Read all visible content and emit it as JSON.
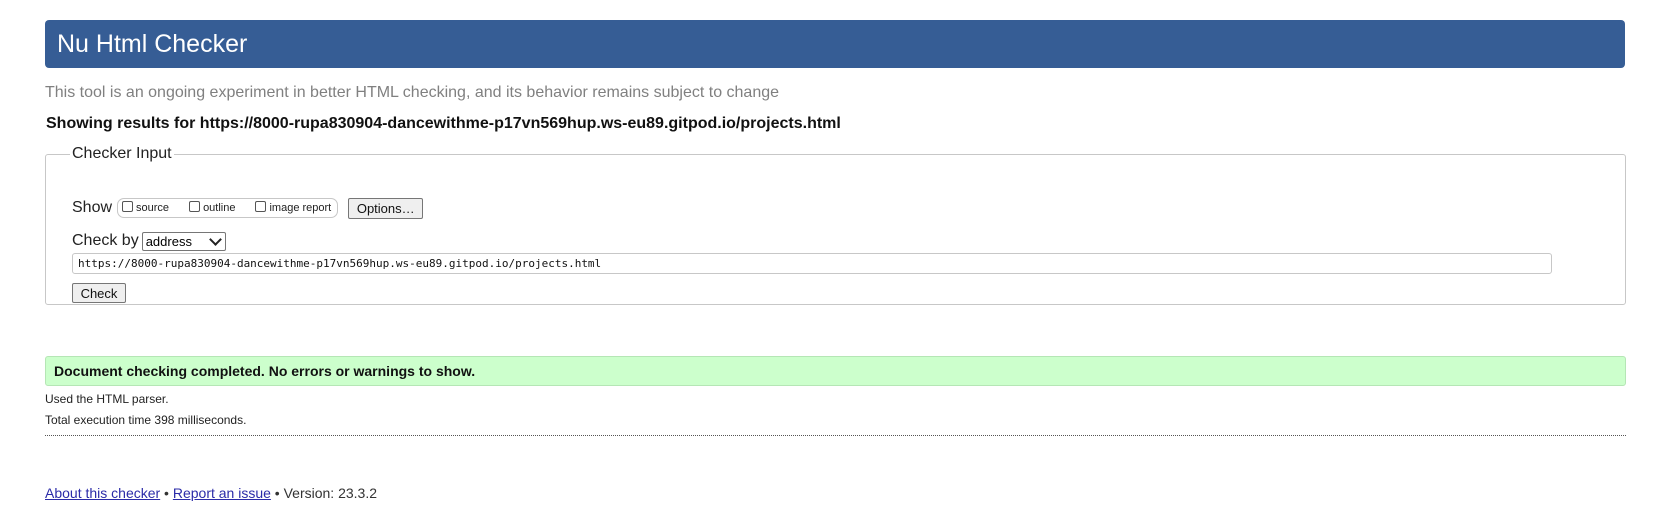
{
  "header": {
    "title": "Nu Html Checker"
  },
  "tagline": "This tool is an ongoing experiment in better HTML checking, and its behavior remains subject to change",
  "results_for": "Showing results for https://8000-rupa830904-dancewithme-p17vn569hup.ws-eu89.gitpod.io/projects.html",
  "checker_input": {
    "legend": "Checker Input",
    "show_label": "Show",
    "show_options": [
      {
        "label": "source",
        "checked": false
      },
      {
        "label": "outline",
        "checked": false
      },
      {
        "label": "image report",
        "checked": false
      }
    ],
    "options_button": "Options…",
    "check_by_label": "Check by",
    "check_by_value": "address",
    "url_value": "https://8000-rupa830904-dancewithme-p17vn569hup.ws-eu89.gitpod.io/projects.html",
    "check_button": "Check"
  },
  "result": {
    "message": "Document checking completed. No errors or warnings to show.",
    "parser_note": "Used the HTML parser.",
    "time_note": "Total execution time 398 milliseconds."
  },
  "footer": {
    "about_link": "About this checker",
    "sep1": " • ",
    "report_link": "Report an issue",
    "sep2": " • ",
    "version": "Version: 23.3.2"
  },
  "colors": {
    "banner": "#365d95",
    "success_bg": "#ccffcc"
  }
}
